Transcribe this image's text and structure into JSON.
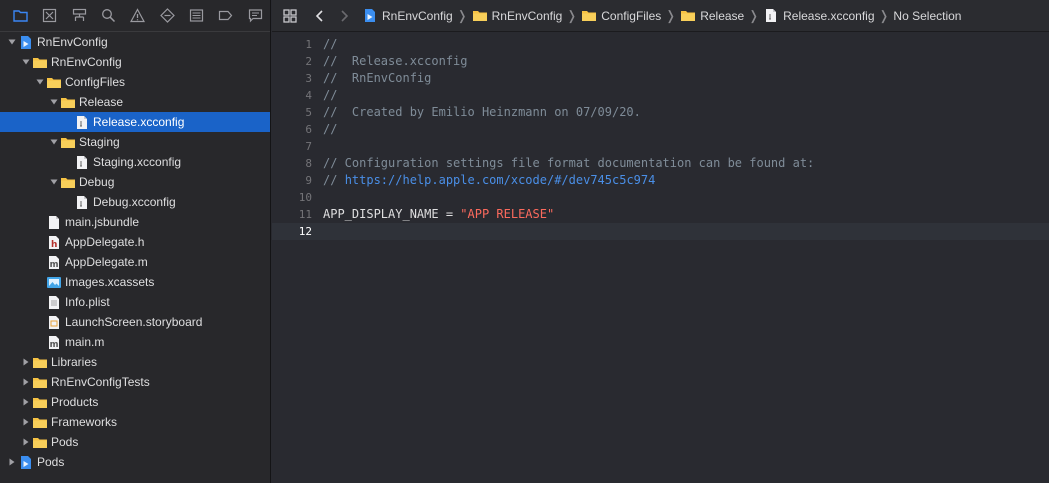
{
  "navigator": {
    "toolbar_icons": [
      "project-navigator-icon",
      "source-control-icon",
      "symbol-navigator-icon",
      "find-icon",
      "issue-navigator-icon",
      "test-navigator-icon",
      "debug-navigator-icon",
      "breakpoint-navigator-icon",
      "report-navigator-icon"
    ],
    "tree": [
      {
        "label": "RnEnvConfig",
        "depth": 0,
        "disclosure": "open",
        "icon": "project-icon"
      },
      {
        "label": "RnEnvConfig",
        "depth": 1,
        "disclosure": "open",
        "icon": "folder-icon"
      },
      {
        "label": "ConfigFiles",
        "depth": 2,
        "disclosure": "open",
        "icon": "folder-icon"
      },
      {
        "label": "Release",
        "depth": 3,
        "disclosure": "open",
        "icon": "folder-icon"
      },
      {
        "label": "Release.xcconfig",
        "depth": 4,
        "disclosure": "none",
        "icon": "xcconfig-file-icon",
        "selected": true
      },
      {
        "label": "Staging",
        "depth": 3,
        "disclosure": "open",
        "icon": "folder-icon"
      },
      {
        "label": "Staging.xcconfig",
        "depth": 4,
        "disclosure": "none",
        "icon": "xcconfig-file-icon"
      },
      {
        "label": "Debug",
        "depth": 3,
        "disclosure": "open",
        "icon": "folder-icon"
      },
      {
        "label": "Debug.xcconfig",
        "depth": 4,
        "disclosure": "none",
        "icon": "xcconfig-file-icon"
      },
      {
        "label": "main.jsbundle",
        "depth": 2,
        "disclosure": "none",
        "icon": "file-icon"
      },
      {
        "label": "AppDelegate.h",
        "depth": 2,
        "disclosure": "none",
        "icon": "header-file-icon"
      },
      {
        "label": "AppDelegate.m",
        "depth": 2,
        "disclosure": "none",
        "icon": "objc-file-icon"
      },
      {
        "label": "Images.xcassets",
        "depth": 2,
        "disclosure": "none",
        "icon": "asset-catalog-icon"
      },
      {
        "label": "Info.plist",
        "depth": 2,
        "disclosure": "none",
        "icon": "plist-file-icon"
      },
      {
        "label": "LaunchScreen.storyboard",
        "depth": 2,
        "disclosure": "none",
        "icon": "storyboard-file-icon"
      },
      {
        "label": "main.m",
        "depth": 2,
        "disclosure": "none",
        "icon": "objc-file-icon"
      },
      {
        "label": "Libraries",
        "depth": 1,
        "disclosure": "closed",
        "icon": "folder-icon"
      },
      {
        "label": "RnEnvConfigTests",
        "depth": 1,
        "disclosure": "closed",
        "icon": "folder-icon"
      },
      {
        "label": "Products",
        "depth": 1,
        "disclosure": "closed",
        "icon": "folder-icon"
      },
      {
        "label": "Frameworks",
        "depth": 1,
        "disclosure": "closed",
        "icon": "folder-icon"
      },
      {
        "label": "Pods",
        "depth": 1,
        "disclosure": "closed",
        "icon": "folder-icon"
      },
      {
        "label": "Pods",
        "depth": 0,
        "disclosure": "closed",
        "icon": "project-icon"
      }
    ]
  },
  "jumpbar": {
    "buttons": [
      "related-items-grid-icon",
      "back-arrow-icon",
      "forward-arrow-icon"
    ],
    "crumbs": [
      {
        "label": "RnEnvConfig",
        "icon": "project-icon"
      },
      {
        "label": "RnEnvConfig",
        "icon": "folder-icon"
      },
      {
        "label": "ConfigFiles",
        "icon": "folder-icon"
      },
      {
        "label": "Release",
        "icon": "folder-icon"
      },
      {
        "label": "Release.xcconfig",
        "icon": "xcconfig-file-icon"
      },
      {
        "label": "No Selection",
        "icon": ""
      }
    ]
  },
  "editor": {
    "current_line": 12,
    "lines": [
      {
        "n": "1",
        "parts": [
          {
            "t": "//",
            "c": "cmt"
          }
        ]
      },
      {
        "n": "2",
        "parts": [
          {
            "t": "//  Release.xcconfig",
            "c": "cmt"
          }
        ]
      },
      {
        "n": "3",
        "parts": [
          {
            "t": "//  RnEnvConfig",
            "c": "cmt"
          }
        ]
      },
      {
        "n": "4",
        "parts": [
          {
            "t": "//",
            "c": "cmt"
          }
        ]
      },
      {
        "n": "5",
        "parts": [
          {
            "t": "//  Created by Emilio Heinzmann on 07/09/20.",
            "c": "cmt"
          }
        ]
      },
      {
        "n": "6",
        "parts": [
          {
            "t": "//",
            "c": "cmt"
          }
        ]
      },
      {
        "n": "7",
        "parts": []
      },
      {
        "n": "8",
        "parts": [
          {
            "t": "// Configuration settings file format documentation can be found at:",
            "c": "cmt"
          }
        ]
      },
      {
        "n": "9",
        "parts": [
          {
            "t": "// ",
            "c": "cmt"
          },
          {
            "t": "https://help.apple.com/xcode/#/dev745c5c974",
            "c": "url"
          }
        ]
      },
      {
        "n": "10",
        "parts": []
      },
      {
        "n": "11",
        "parts": [
          {
            "t": "APP_DISPLAY_NAME = ",
            "c": "plain"
          },
          {
            "t": "\"APP RELEASE\"",
            "c": "str"
          }
        ]
      },
      {
        "n": "12",
        "parts": []
      }
    ]
  },
  "colors": {
    "selection": "#1a63c8",
    "folder": "#f6c244",
    "comment": "#7f8c98",
    "link": "#4a8fe7",
    "string": "#fc6a5d"
  }
}
